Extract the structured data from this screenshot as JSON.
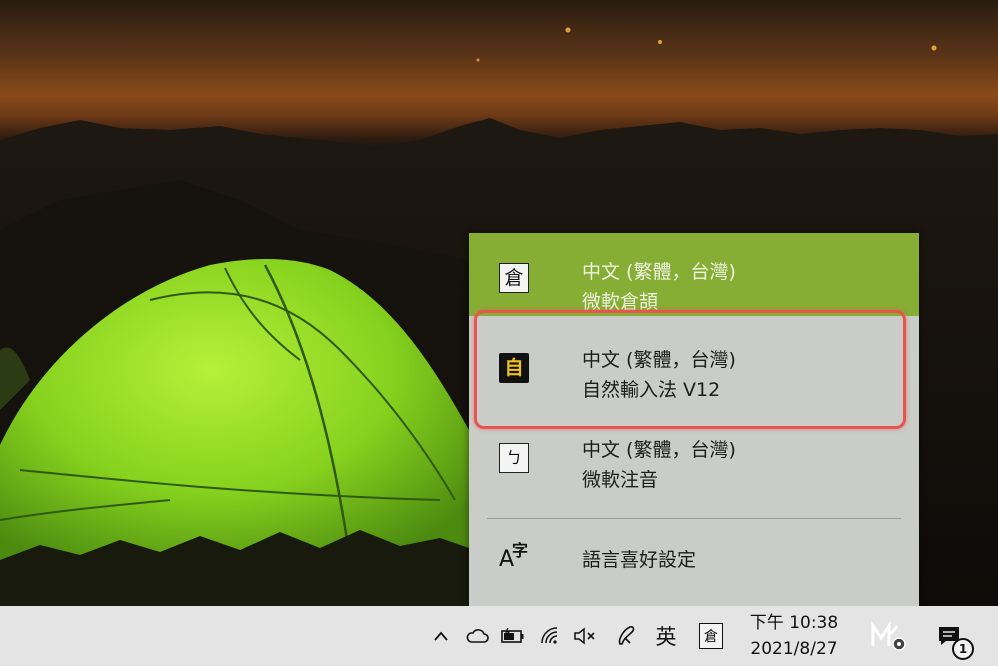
{
  "flyout": {
    "items": [
      {
        "icon": "倉",
        "language": "中文 (繁體，台灣)",
        "ime": "微軟倉頡",
        "state": "selected"
      },
      {
        "icon": "自",
        "language": "中文 (繁體，台灣)",
        "ime": "自然輸入法 V12",
        "state": "highlighted"
      },
      {
        "icon": "ㄅ",
        "language": "中文 (繁體，台灣)",
        "ime": "微軟注音",
        "state": "normal"
      }
    ],
    "preferences": {
      "icon_big": "A",
      "icon_small": "字",
      "label": "語言喜好設定"
    },
    "colors": {
      "active": "#86ad34",
      "highlight_border": "#e8554e"
    }
  },
  "taskbar": {
    "input_mode": "英",
    "ime_indicator": "倉",
    "clock": {
      "time": "下午 10:38",
      "date": "2021/8/27"
    },
    "notification_count": "1",
    "tray_icons": [
      "chevron-up-icon",
      "onedrive-cloud-icon",
      "battery-icon",
      "wifi-icon",
      "volume-muted-icon",
      "pen-icon",
      "meet-now-icon",
      "action-center-icon"
    ]
  }
}
